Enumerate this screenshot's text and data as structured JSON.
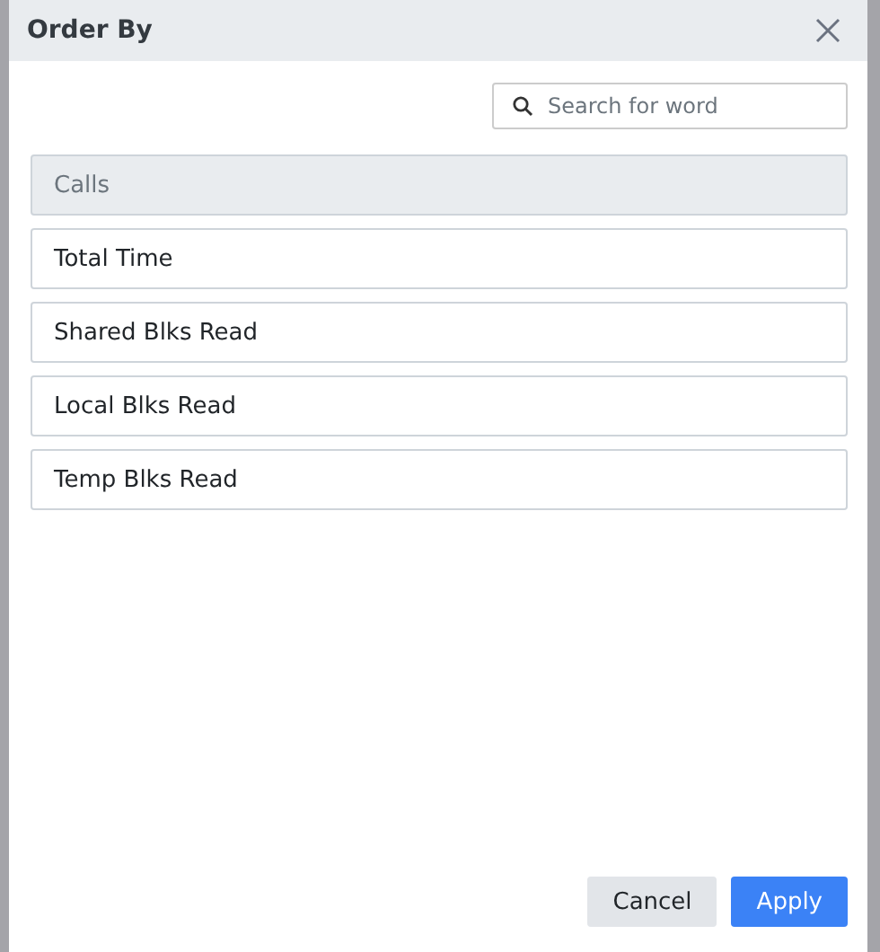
{
  "dialog": {
    "title": "Order By"
  },
  "search": {
    "placeholder": "Search for word"
  },
  "options": [
    {
      "label": "Calls",
      "selected": true
    },
    {
      "label": "Total Time",
      "selected": false
    },
    {
      "label": "Shared Blks Read",
      "selected": false
    },
    {
      "label": "Local Blks Read",
      "selected": false
    },
    {
      "label": "Temp Blks Read",
      "selected": false
    }
  ],
  "buttons": [
    {
      "label": "Cancel",
      "kind": "secondary"
    },
    {
      "label": "Apply",
      "kind": "primary"
    }
  ]
}
